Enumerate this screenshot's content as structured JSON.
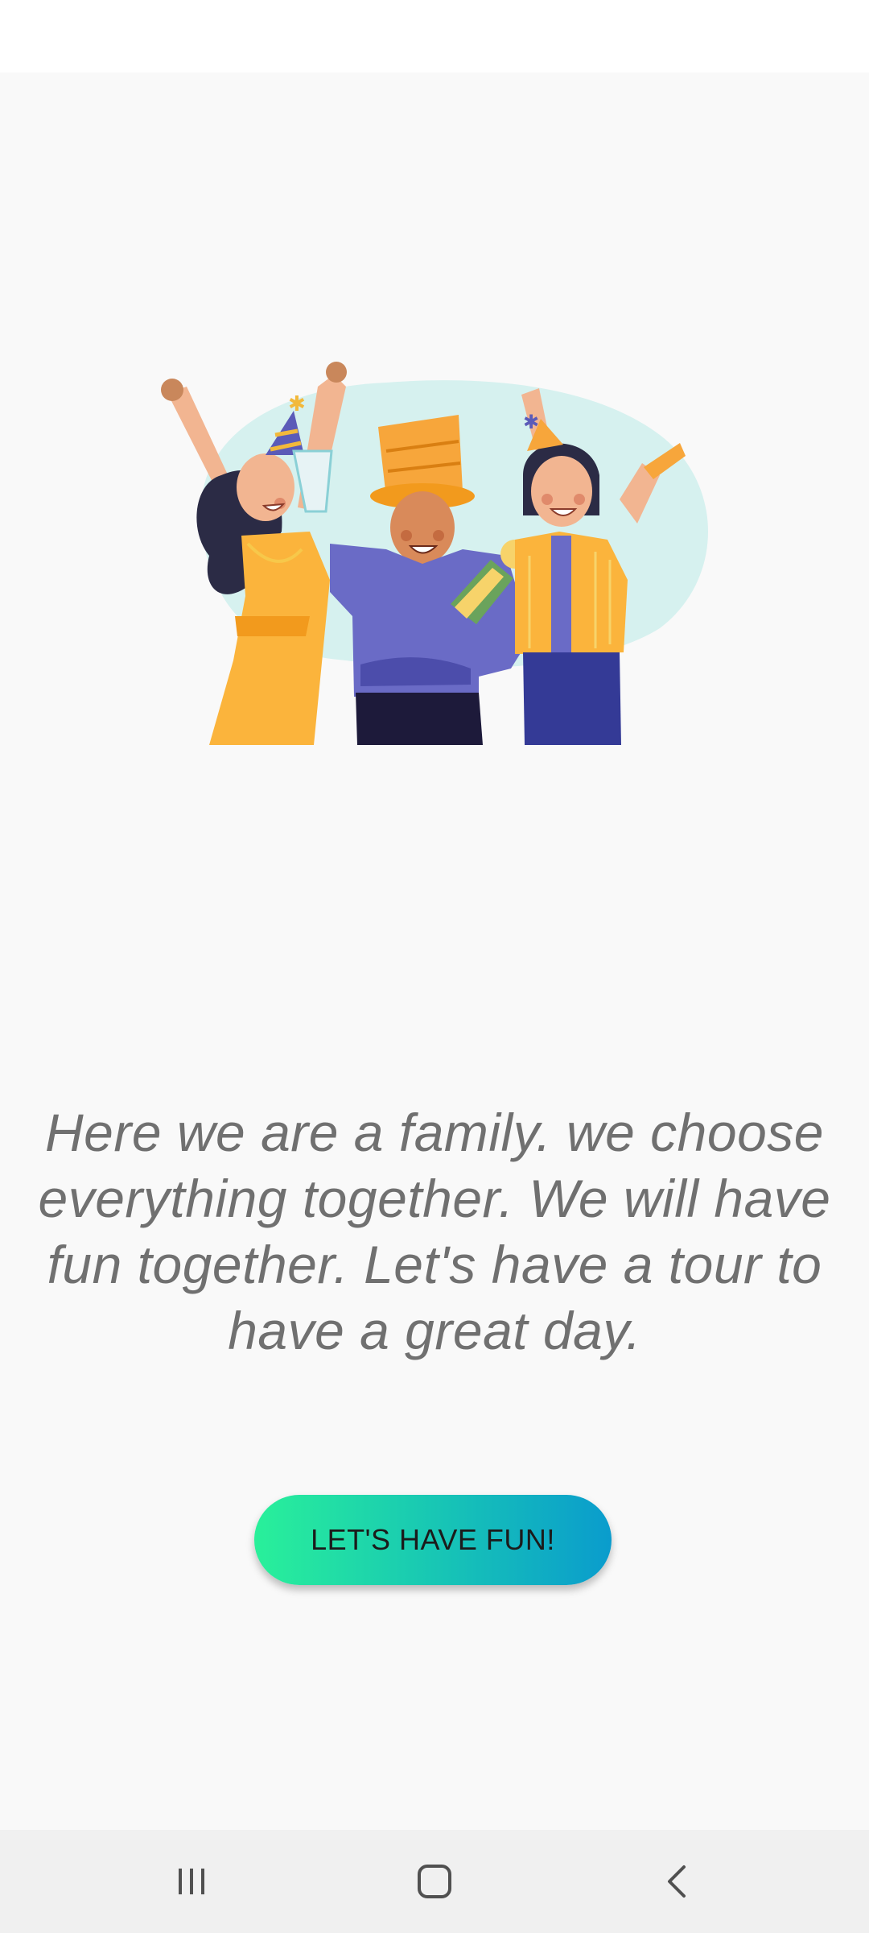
{
  "onboarding": {
    "message": "Here we are a family. we choose everything together. We will have fun together. Let's have a tour to have a great day.",
    "cta_label": "LET'S HAVE FUN!"
  },
  "illustration": {
    "icon": "party-people-illustration"
  },
  "navigation_bar": {
    "recent_icon": "recent-apps-icon",
    "home_icon": "home-icon",
    "back_icon": "back-icon"
  },
  "colors": {
    "background": "#f9f9f9",
    "cta_gradient_start": "#29f09a",
    "cta_gradient_end": "#0a9ccd",
    "text_gray": "#707070"
  }
}
